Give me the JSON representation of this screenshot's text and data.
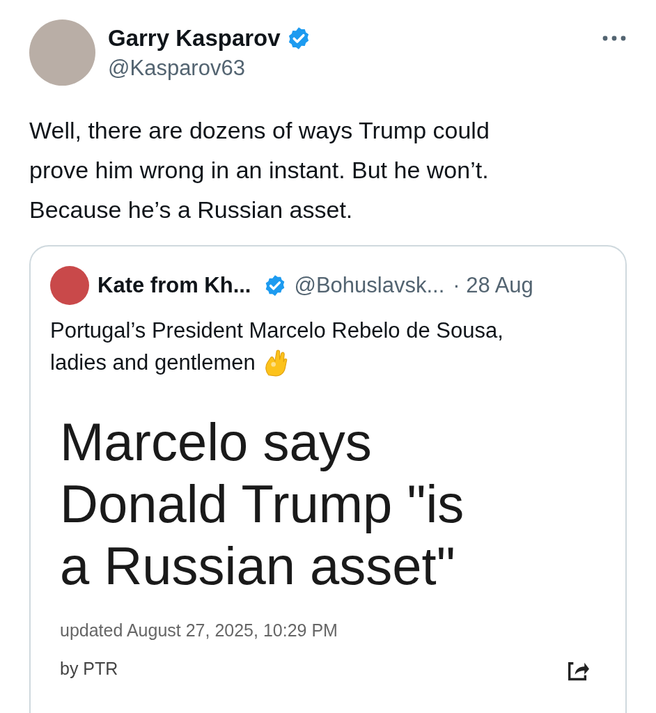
{
  "author": {
    "name": "Garry Kasparov",
    "handle": "@Kasparov63",
    "verified": true
  },
  "tweet_text": [
    "Well, there are dozens of ways Trump could",
    "prove him wrong in an instant. But he won’t.",
    "Because he’s a Russian asset."
  ],
  "quoted_tweet": {
    "name": "Kate from Kh...",
    "verified": true,
    "handle": "@Bohuslavsk...",
    "date": "· 28 Aug",
    "text": [
      "Portugal’s President Marcelo Rebelo de Sousa,",
      "ladies and gentlemen"
    ],
    "article": {
      "headline": [
        "Marcelo says",
        "Donald Trump \"is",
        "a Russian asset\""
      ],
      "updated": "updated August 27, 2025, 10:29 PM",
      "byline": "by PTR"
    }
  }
}
